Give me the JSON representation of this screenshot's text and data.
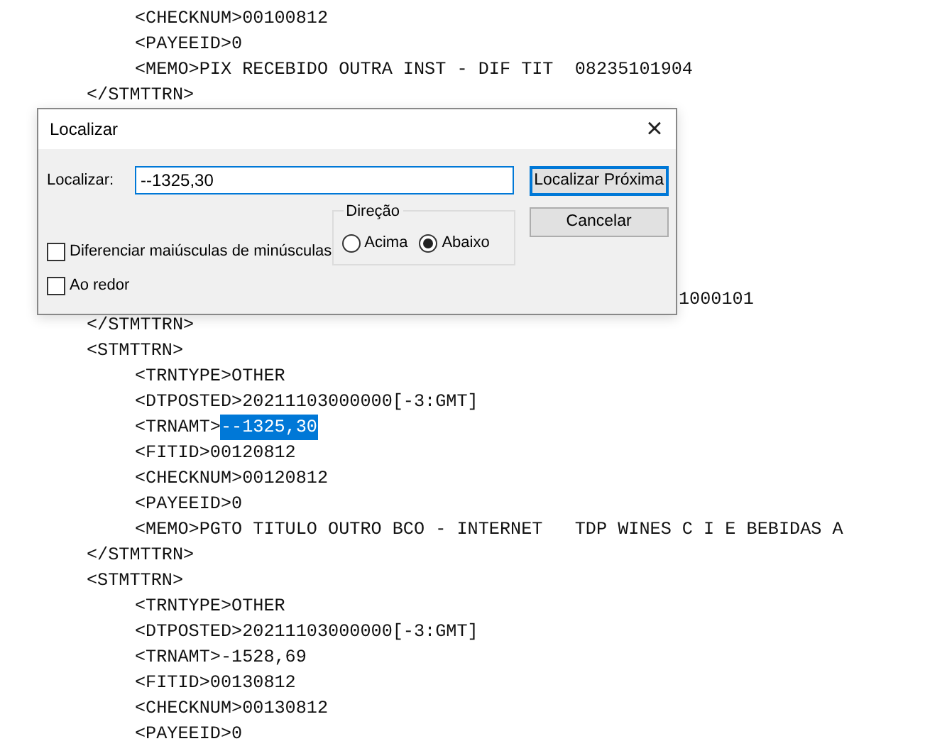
{
  "editor": {
    "lines_above": [
      {
        "kind": "field",
        "text": "<CHECKNUM>00100812"
      },
      {
        "kind": "field",
        "text": "<PAYEEID>0"
      },
      {
        "kind": "field",
        "text": "<MEMO>PIX RECEBIDO OUTRA INST - DIF TIT  08235101904"
      },
      {
        "kind": "block",
        "text": "</STMTTRN>"
      }
    ],
    "lines_below": [
      {
        "kind": "fragment",
        "text": "1000101"
      },
      {
        "kind": "block",
        "text": "</STMTTRN>"
      },
      {
        "kind": "block",
        "text": "<STMTTRN>"
      },
      {
        "kind": "field",
        "text": "<TRNTYPE>OTHER"
      },
      {
        "kind": "field",
        "text": "<DTPOSTED>20211103000000[-3:GMT]"
      },
      {
        "kind": "field",
        "text": "<TRNAMT>",
        "selection": "--1325,30"
      },
      {
        "kind": "field",
        "text": "<FITID>00120812"
      },
      {
        "kind": "field",
        "text": "<CHECKNUM>00120812"
      },
      {
        "kind": "field",
        "text": "<PAYEEID>0"
      },
      {
        "kind": "field",
        "text": "<MEMO>PGTO TITULO OUTRO BCO - INTERNET   TDP WINES C I E BEBIDAS A"
      },
      {
        "kind": "block",
        "text": "</STMTTRN>"
      },
      {
        "kind": "block",
        "text": "<STMTTRN>"
      },
      {
        "kind": "field",
        "text": "<TRNTYPE>OTHER"
      },
      {
        "kind": "field",
        "text": "<DTPOSTED>20211103000000[-3:GMT]"
      },
      {
        "kind": "field",
        "text": "<TRNAMT>-1528,69"
      },
      {
        "kind": "field",
        "text": "<FITID>00130812"
      },
      {
        "kind": "field",
        "text": "<CHECKNUM>00130812"
      },
      {
        "kind": "field",
        "text": "<PAYEEID>0"
      }
    ]
  },
  "dialog": {
    "title": "Localizar",
    "close": "×",
    "find_label": "Localizar:",
    "find_value": "--1325,30",
    "buttons": [
      {
        "label": "Localizar Próxima",
        "default": true
      },
      {
        "label": "Cancelar",
        "default": false
      }
    ],
    "direction": {
      "title": "Direção",
      "options": [
        {
          "label": "Acima",
          "selected": false
        },
        {
          "label": "Abaixo",
          "selected": true
        }
      ]
    },
    "checkboxes": [
      {
        "label": "Diferenciar maiúsculas de minúsculas",
        "checked": false
      },
      {
        "label": "Ao redor",
        "checked": false
      }
    ]
  }
}
